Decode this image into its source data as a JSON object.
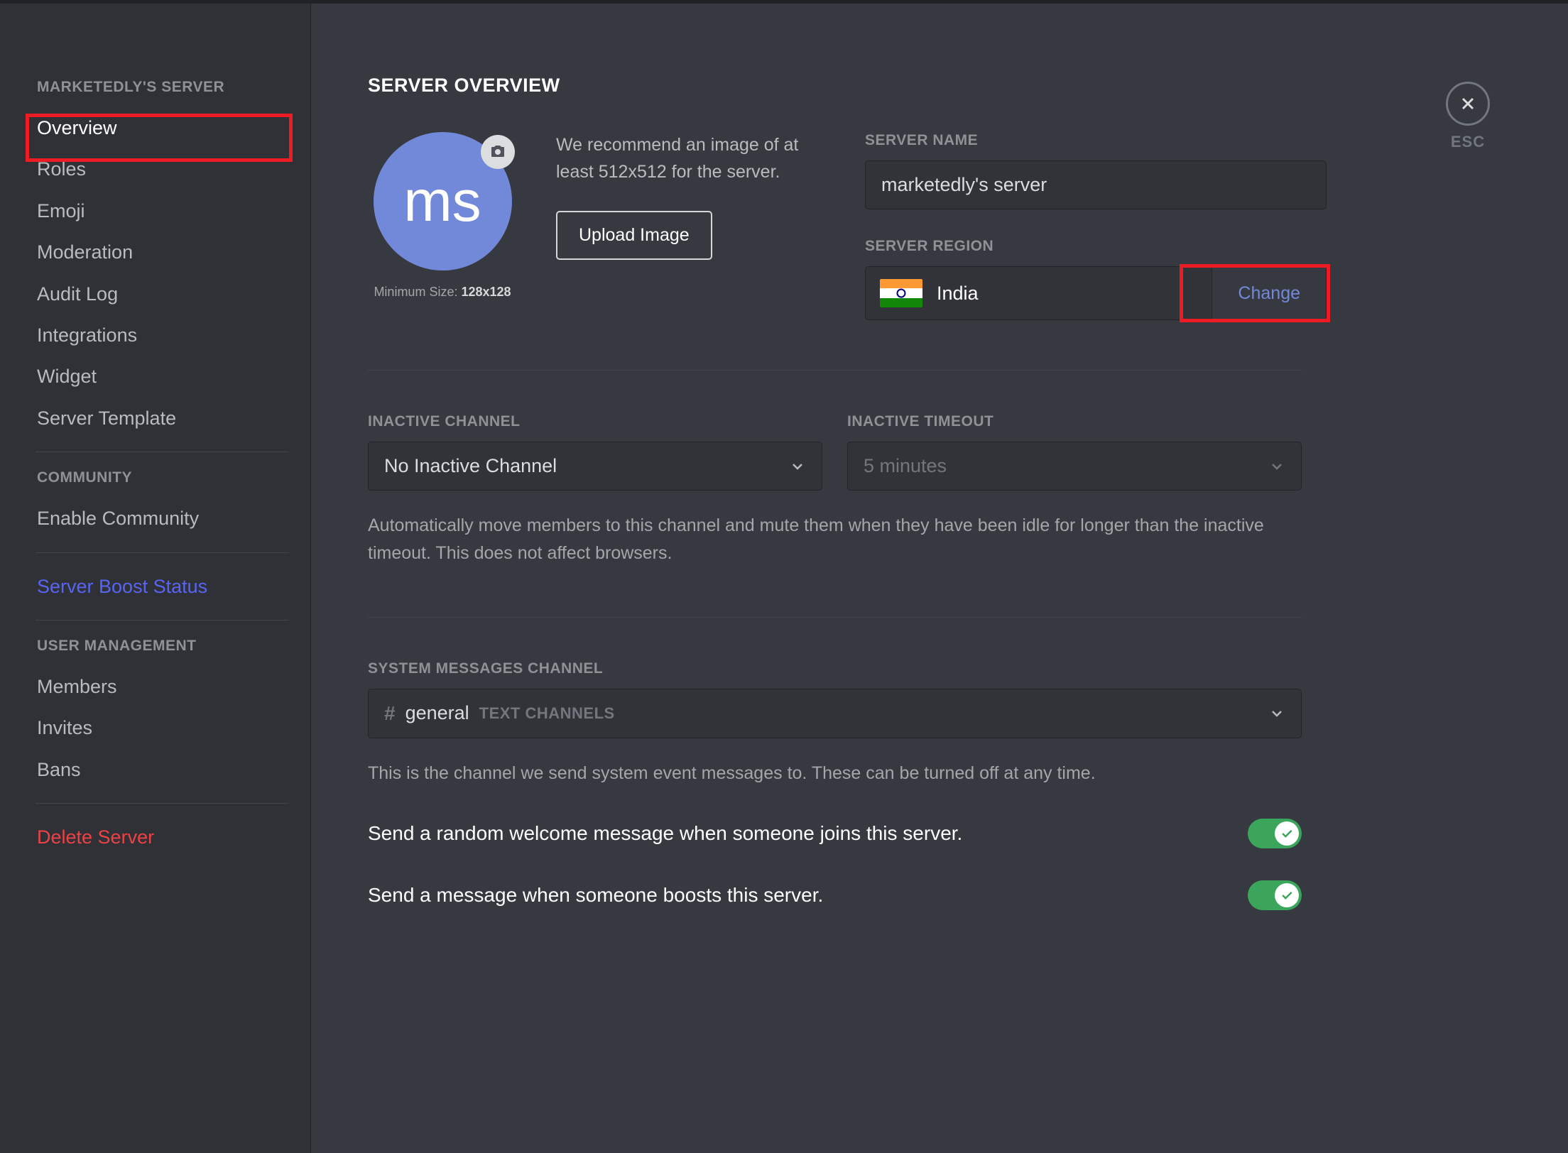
{
  "sidebar": {
    "sections": [
      {
        "header": "MARKETEDLY'S SERVER",
        "items": [
          "Overview",
          "Roles",
          "Emoji",
          "Moderation",
          "Audit Log",
          "Integrations",
          "Widget",
          "Server Template"
        ]
      },
      {
        "header": "COMMUNITY",
        "items": [
          "Enable Community"
        ]
      },
      {
        "boost": "Server Boost Status"
      },
      {
        "header": "USER MANAGEMENT",
        "items": [
          "Members",
          "Invites",
          "Bans"
        ]
      },
      {
        "delete": "Delete Server"
      }
    ]
  },
  "esc_label": "ESC",
  "page_title": "SERVER OVERVIEW",
  "avatar_text": "ms",
  "min_size_prefix": "Minimum Size: ",
  "min_size_value": "128x128",
  "recommend_text": "We recommend an image of at least 512x512 for the server.",
  "upload_button": "Upload Image",
  "server_name_label": "SERVER NAME",
  "server_name_value": "marketedly's server",
  "server_region_label": "SERVER REGION",
  "region_name": "India",
  "change_label": "Change",
  "inactive_channel_label": "INACTIVE CHANNEL",
  "inactive_channel_value": "No Inactive Channel",
  "inactive_timeout_label": "INACTIVE TIMEOUT",
  "inactive_timeout_value": "5 minutes",
  "inactive_helper": "Automatically move members to this channel and mute them when they have been idle for longer than the inactive timeout. This does not affect browsers.",
  "system_channel_label": "SYSTEM MESSAGES CHANNEL",
  "system_channel_name": "general",
  "system_channel_category": "TEXT CHANNELS",
  "system_helper": "This is the channel we send system event messages to. These can be turned off at any time.",
  "toggle_welcome": "Send a random welcome message when someone joins this server.",
  "toggle_boost": "Send a message when someone boosts this server."
}
